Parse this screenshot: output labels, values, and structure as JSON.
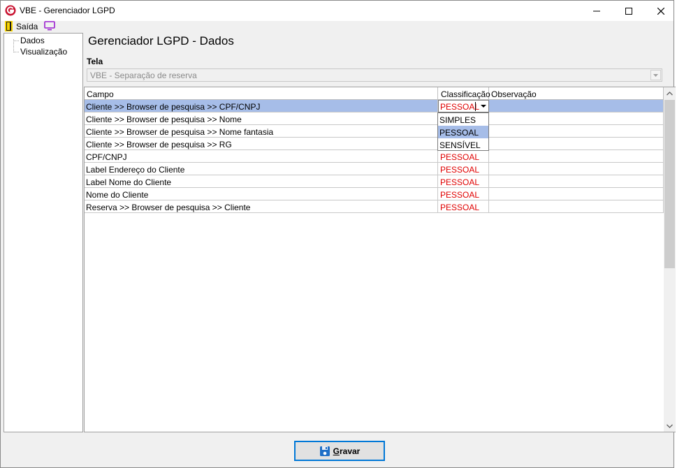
{
  "window": {
    "title": "VBE - Gerenciador LGPD",
    "minimize_icon": "minimize-icon",
    "maximize_icon": "maximize-icon",
    "close_icon": "close-icon"
  },
  "menu": {
    "exit_label": "Saída",
    "exit_icon": "door-exit-icon",
    "screen_icon": "monitor-icon"
  },
  "tree": {
    "items": [
      {
        "label": "Dados"
      },
      {
        "label": "Visualização"
      }
    ]
  },
  "main": {
    "title": "Gerenciador LGPD - Dados",
    "tela_label": "Tela",
    "tela_value": "VBE - Separação de reserva"
  },
  "grid": {
    "columns": [
      "Campo",
      "Classificação",
      "Observação"
    ],
    "rows": [
      {
        "campo": "Cliente >> Browser de pesquisa >> CPF/CNPJ",
        "classificacao": "PESSOAL",
        "observacao": ""
      },
      {
        "campo": "Cliente >> Browser de pesquisa >> Nome",
        "classificacao": "",
        "observacao": ""
      },
      {
        "campo": "Cliente >> Browser de pesquisa >> Nome fantasia",
        "classificacao": "",
        "observacao": ""
      },
      {
        "campo": "Cliente >> Browser de pesquisa >> RG",
        "classificacao": "",
        "observacao": ""
      },
      {
        "campo": "CPF/CNPJ",
        "classificacao": "PESSOAL",
        "observacao": ""
      },
      {
        "campo": "Label Endereço do Cliente",
        "classificacao": "PESSOAL",
        "observacao": ""
      },
      {
        "campo": "Label Nome do Cliente",
        "classificacao": "PESSOAL",
        "observacao": ""
      },
      {
        "campo": "Nome do Cliente",
        "classificacao": "PESSOAL",
        "observacao": ""
      },
      {
        "campo": "Reserva >> Browser de pesquisa >> Cliente",
        "classificacao": "PESSOAL",
        "observacao": ""
      }
    ],
    "dropdown_options": [
      "SIMPLES",
      "PESSOAL",
      "SENSÍVEL"
    ],
    "dropdown_highlighted": "PESSOAL"
  },
  "footer": {
    "save_label_accel": "G",
    "save_label_rest": "ravar",
    "save_icon": "floppy-disk-icon"
  },
  "colors": {
    "selection": "#a6bde8",
    "classification_text": "#e00000",
    "focus_border": "#0078d7"
  }
}
